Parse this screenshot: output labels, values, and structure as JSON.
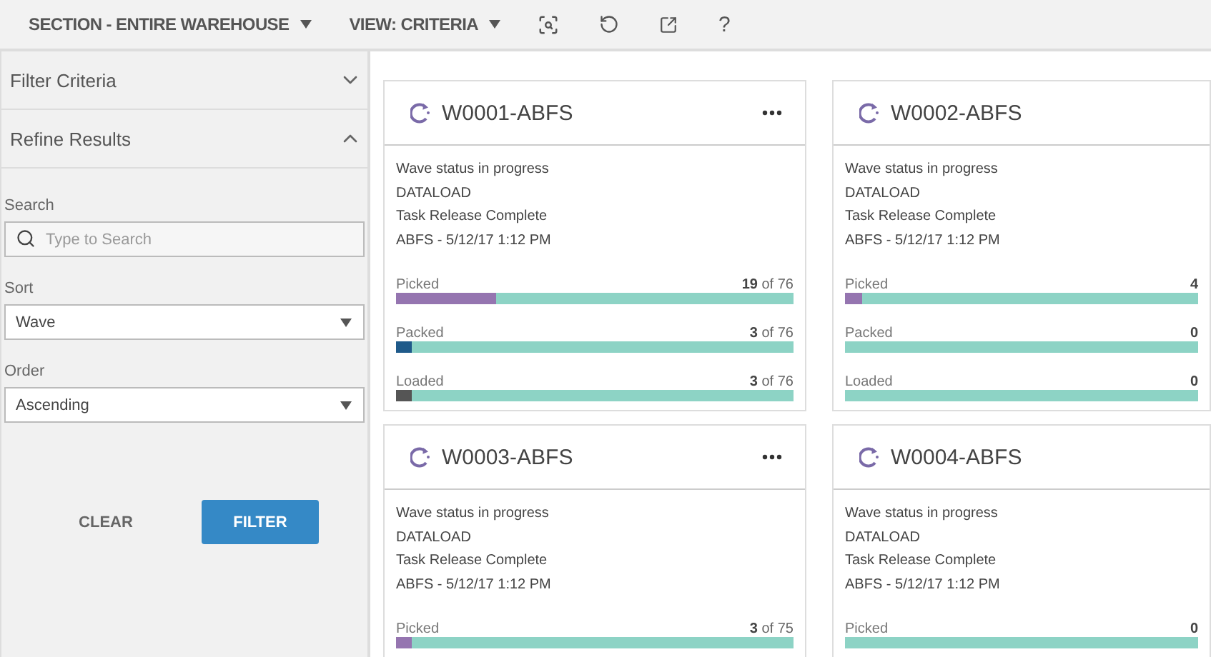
{
  "toolbar": {
    "section": "SECTION - ENTIRE WAREHOUSE",
    "view": "VIEW: CRITERIA",
    "help": "?"
  },
  "sidebar": {
    "sections": [
      {
        "title": "Filter Criteria",
        "expanded": false
      },
      {
        "title": "Refine Results",
        "expanded": true
      }
    ],
    "search": {
      "label": "Search",
      "placeholder": "Type to Search"
    },
    "sort": {
      "label": "Sort",
      "value": "Wave"
    },
    "order": {
      "label": "Order",
      "value": "Ascending"
    },
    "buttons": {
      "clear": "CLEAR",
      "filter": "FILTER"
    }
  },
  "cards": [
    {
      "title": "W0001-ABFS",
      "menu": true,
      "lines": [
        "Wave status in progress",
        "DATALOAD",
        "Task Release Complete",
        "ABFS - 5/12/17 1:12 PM"
      ],
      "metrics": [
        {
          "label": "Picked",
          "count": "19",
          "total": " of 76",
          "level": 0.25,
          "color": "#9575b0"
        },
        {
          "label": "Packed",
          "count": "3",
          "total": " of 76",
          "level": 0.04,
          "color": "#1f5a8a"
        },
        {
          "label": "Loaded",
          "count": "3",
          "total": " of 76",
          "level": 0.04,
          "color": "#555555"
        }
      ]
    },
    {
      "title": "W0002-ABFS",
      "menu": false,
      "lines": [
        "Wave status in progress",
        "DATALOAD",
        "Task Release Complete",
        "ABFS - 5/12/17 1:12 PM"
      ],
      "metrics": [
        {
          "label": "Picked",
          "count": "4",
          "level": 0.05,
          "color": "#9575b0"
        },
        {
          "label": "Packed",
          "count": "0"
        },
        {
          "label": "Loaded",
          "count": "0"
        }
      ]
    },
    {
      "title": "W0003-ABFS",
      "menu": true,
      "lines": [
        "Wave status in progress",
        "DATALOAD",
        "Task Release Complete",
        "ABFS - 5/12/17 1:12 PM"
      ],
      "metrics": [
        {
          "label": "Picked",
          "count": "3",
          "total": " of 75",
          "level": 0.04,
          "color": "#9575b0"
        }
      ]
    },
    {
      "title": "W0004-ABFS",
      "menu": false,
      "lines": [
        "Wave status in progress",
        "DATALOAD",
        "Task Release Complete",
        "ABFS - 5/12/17 1:12 PM"
      ],
      "metrics": [
        {
          "label": "Picked",
          "count": "0"
        }
      ]
    }
  ]
}
